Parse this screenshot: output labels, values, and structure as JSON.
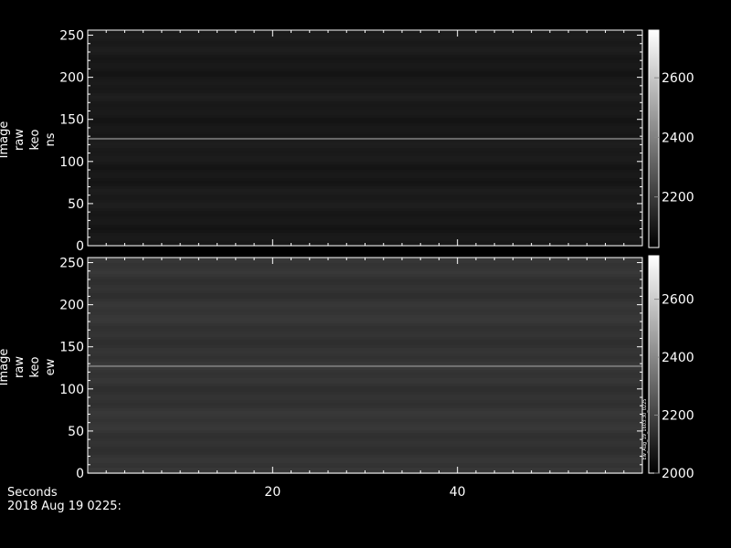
{
  "chart_data": [
    {
      "type": "heatmap",
      "ylabel": "Image raw keo ns",
      "ylabel_lines": [
        "Image",
        "raw",
        "keo",
        "ns"
      ],
      "ylim": [
        0,
        256
      ],
      "yticks": [
        0,
        50,
        100,
        150,
        200,
        250
      ],
      "xlim": [
        0,
        60
      ],
      "xticks": [
        20,
        40
      ],
      "show_x_tick_labels": false,
      "colorbar": {
        "range": [
          2030,
          2760
        ],
        "ticks": [
          2200,
          2400,
          2600
        ]
      },
      "bright_rows": [
        {
          "y": 127,
          "intensity": 0.42
        },
        {
          "y": 148,
          "intensity": 0.08
        }
      ],
      "base_intensity": 0.1
    },
    {
      "type": "heatmap",
      "ylabel": "Image raw keo ew",
      "ylabel_lines": [
        "Image",
        "raw",
        "keo",
        "ew"
      ],
      "ylim": [
        0,
        256
      ],
      "yticks": [
        0,
        50,
        100,
        150,
        200,
        250
      ],
      "xlim": [
        0,
        60
      ],
      "xticks": [
        20,
        40
      ],
      "show_x_tick_labels": true,
      "colorbar": {
        "range": [
          2000,
          2750
        ],
        "ticks": [
          2000,
          2200,
          2400,
          2600
        ]
      },
      "bright_rows": [
        {
          "y": 127,
          "intensity": 0.45
        },
        {
          "y": 5,
          "intensity": 0.22
        }
      ],
      "base_intensity": 0.2,
      "side_note": "Ew_Aug_19_1603:30_0225"
    }
  ],
  "footer": {
    "xlabel": "Seconds",
    "date": "2018 Aug 19 0225:"
  }
}
